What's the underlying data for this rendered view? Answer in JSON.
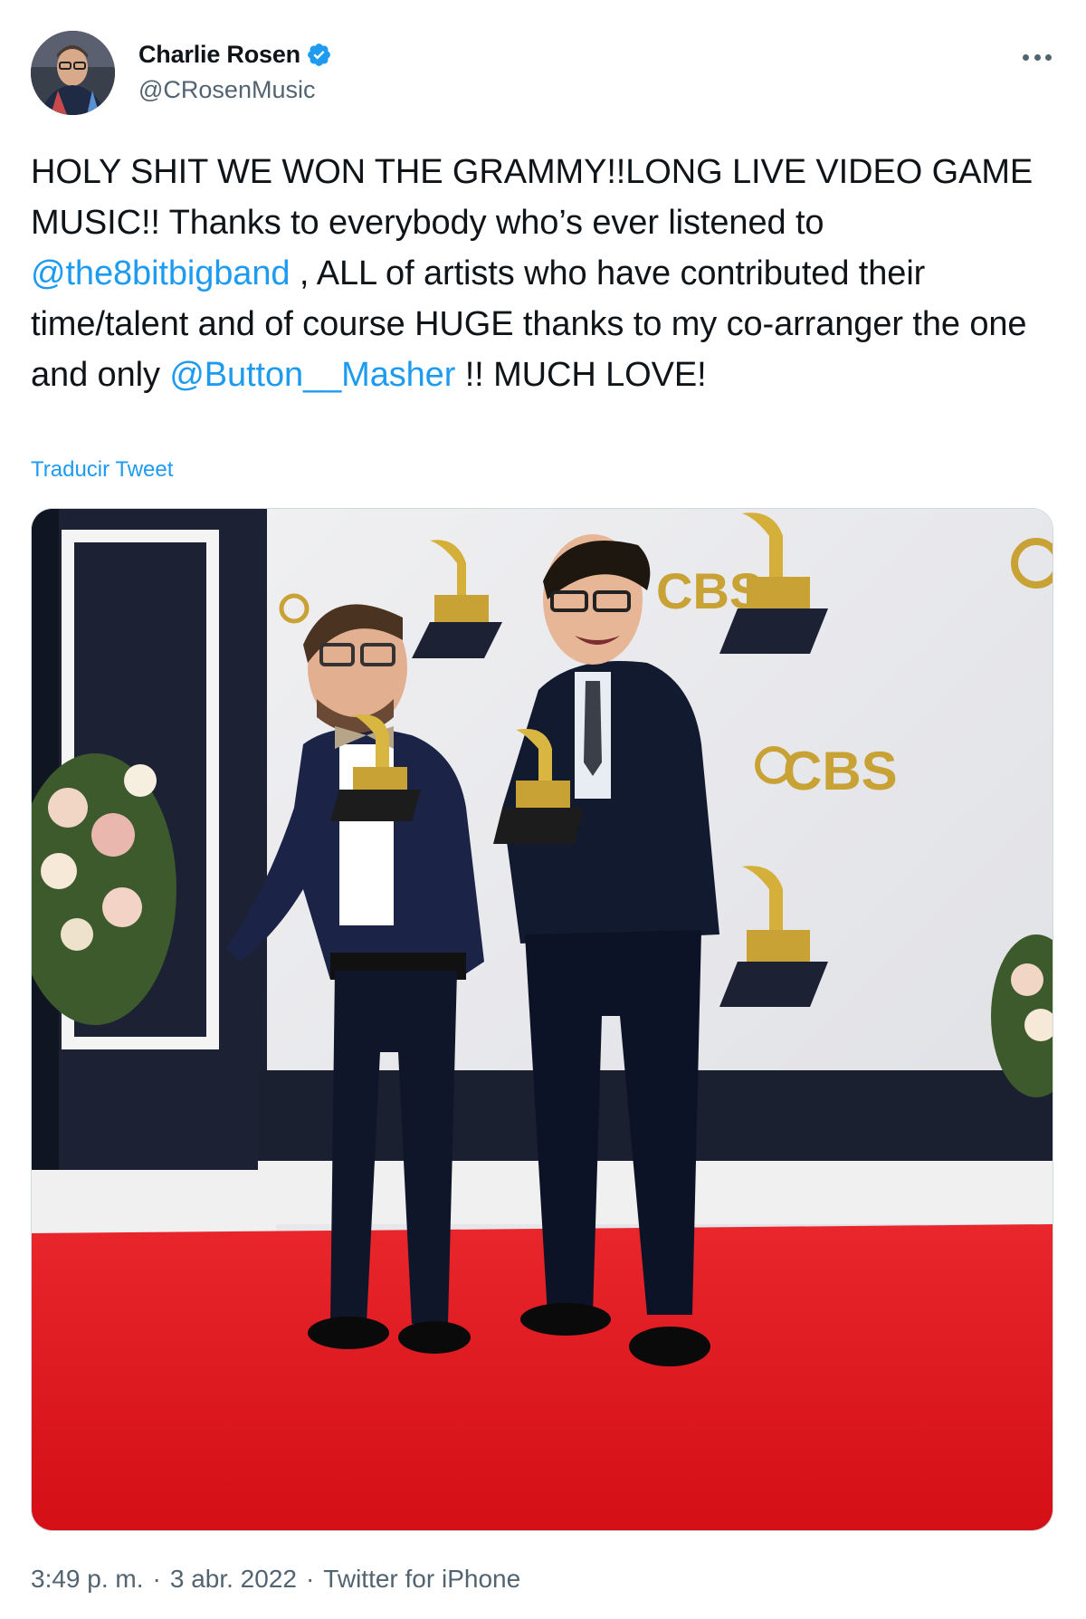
{
  "author": {
    "name": "Charlie Rosen",
    "handle": "@CRosenMusic",
    "verified": true
  },
  "tweet": {
    "text_part1": "HOLY SHIT WE WON THE GRAMMY!!LONG LIVE VIDEO GAME MUSIC!! Thanks to everybody who’s ever listened to ",
    "mention1": "@the8bitbigband",
    "text_part2": " , ALL of artists who have contributed their time/talent and of course HUGE thanks to my co-arranger the one and only ",
    "mention2": "@Button__Masher",
    "text_part3": " !! MUCH LOVE!",
    "translate_label": "Traducir Tweet"
  },
  "photo": {
    "backdrop_logo": "CBS"
  },
  "meta": {
    "time": "3:49 p. m.",
    "separator": "·",
    "date": "3 abr. 2022",
    "source": "Twitter for iPhone"
  },
  "colors": {
    "link": "#1d9bf0",
    "secondary_text": "#536471",
    "primary_text": "#0f1419",
    "carpet": "#e3141b",
    "gold": "#c9a236"
  },
  "icons": {
    "verified": "verified-badge-icon",
    "more": "more-options-icon"
  }
}
